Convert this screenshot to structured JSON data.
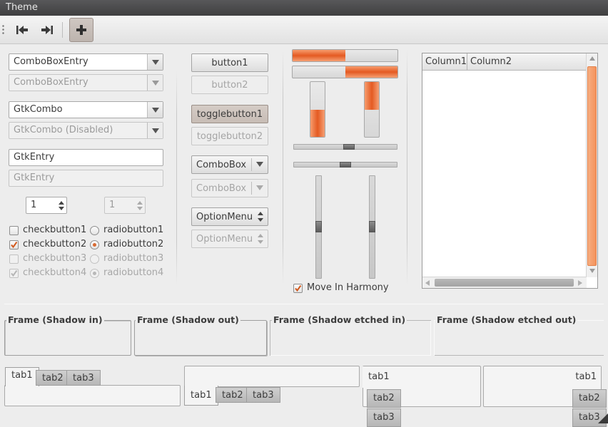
{
  "window": {
    "title": "Theme"
  },
  "toolbar": {
    "buttons": [
      {
        "icon": "go-first-icon"
      },
      {
        "icon": "go-last-icon"
      },
      {
        "icon": "add-icon"
      }
    ]
  },
  "left": {
    "combo_entry_1": "ComboBoxEntry",
    "combo_entry_2": "ComboBoxEntry",
    "gtkcombo_1": "GtkCombo",
    "gtkcombo_2": "GtkCombo (Disabled)",
    "entry_1": "GtkEntry",
    "entry_2": "GtkEntry",
    "spin_1": "1",
    "spin_2": "1",
    "checks": [
      {
        "check_label": "checkbutton1",
        "check_checked": false,
        "radio_label": "radiobutton1",
        "radio_checked": false,
        "disabled": false
      },
      {
        "check_label": "checkbutton2",
        "check_checked": true,
        "radio_label": "radiobutton2",
        "radio_checked": true,
        "disabled": false
      },
      {
        "check_label": "checkbutton3",
        "check_checked": false,
        "radio_label": "radiobutton3",
        "radio_checked": false,
        "disabled": true
      },
      {
        "check_label": "checkbutton4",
        "check_checked": true,
        "radio_label": "radiobutton4",
        "radio_checked": true,
        "disabled": true
      }
    ]
  },
  "buttons": {
    "button1": "button1",
    "button2": "button2",
    "toggle1": "togglebutton1",
    "toggle2": "togglebutton2",
    "combobox1": "ComboBox",
    "combobox2": "ComboBox",
    "optionmenu1": "OptionMenu",
    "optionmenu2": "OptionMenu"
  },
  "progress": {
    "h1_fraction": 0.5,
    "h2_fraction": 0.5,
    "v1_fraction": 0.5,
    "v2_fraction": 0.5
  },
  "scales": {
    "move_in_harmony_label": "Move In Harmony",
    "move_in_harmony_checked": true
  },
  "tree": {
    "columns": [
      "Column1",
      "Column2"
    ]
  },
  "frames": {
    "f1": "Frame (Shadow in)",
    "f2": "Frame (Shadow out)",
    "f3": "Frame (Shadow etched in)",
    "f4": "Frame (Shadow etched out)"
  },
  "notebooks": {
    "tabs": [
      "tab1",
      "tab2",
      "tab3"
    ]
  },
  "colors": {
    "accent": "#e45a22",
    "titlebar": "#4b4b4c"
  }
}
